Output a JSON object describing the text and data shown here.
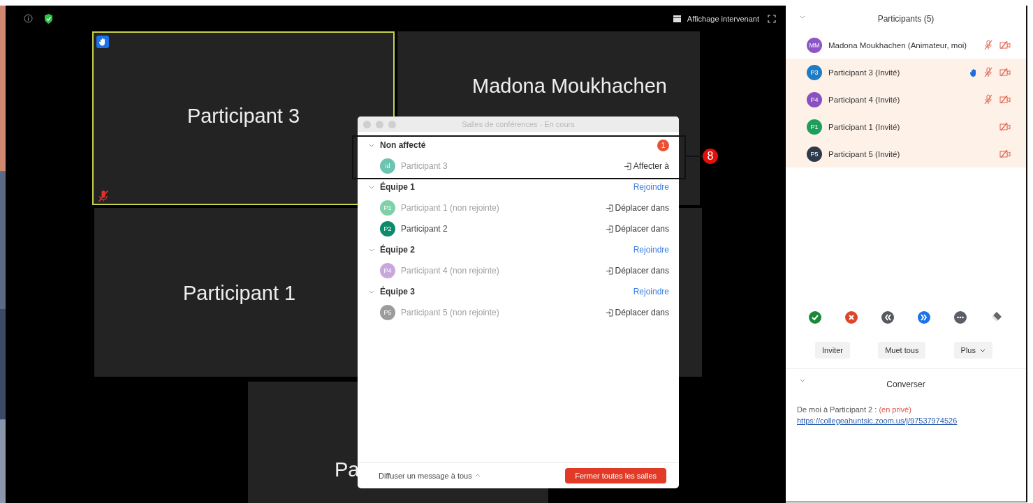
{
  "top_bar": {
    "view_label": "Affichage intervenant"
  },
  "tiles": [
    {
      "name": "Participant 3",
      "active": true,
      "hand_raised": true,
      "mic_muted": true
    },
    {
      "name": "Madona Moukhachen",
      "active": false,
      "hand_raised": false,
      "mic_muted": false
    },
    {
      "name": "Participant 1",
      "active": false,
      "hand_raised": false,
      "mic_muted": false
    },
    {
      "name": "Pa",
      "active": false,
      "hand_raised": false,
      "mic_muted": false
    }
  ],
  "dialog": {
    "title": "Salles de conférences - En cours",
    "groups": [
      {
        "name": "Non affecté",
        "badge": "1",
        "callout": "8",
        "members": [
          {
            "initials": "id",
            "name": "Participant 3",
            "color": "#6cc4b0",
            "joined": false,
            "action": "Affecter à"
          }
        ]
      },
      {
        "name": "Équipe 1",
        "link": "Rejoindre",
        "members": [
          {
            "initials": "P1",
            "name": "Participant 1 (non rejointe)",
            "color": "#80d0aa",
            "joined": false,
            "action": "Déplacer dans"
          },
          {
            "initials": "P2",
            "name": "Participant 2",
            "color": "#0b8a6c",
            "joined": true,
            "action": "Déplacer dans"
          }
        ]
      },
      {
        "name": "Équipe 2",
        "link": "Rejoindre",
        "members": [
          {
            "initials": "P4",
            "name": "Participant 4 (non rejointe)",
            "color": "#c8a8dc",
            "joined": false,
            "action": "Déplacer dans"
          }
        ]
      },
      {
        "name": "Équipe 3",
        "link": "Rejoindre",
        "members": [
          {
            "initials": "P5",
            "name": "Participant 5 (non rejointe)",
            "color": "#9c9c9c",
            "joined": false,
            "action": "Déplacer dans"
          }
        ]
      }
    ],
    "broadcast": "Diffuser un message à tous",
    "close_button": "Fermer toutes les salles"
  },
  "participants_panel": {
    "title": "Participants (5)",
    "participants": [
      {
        "initials": "MM",
        "name": "Madona Moukhachen (Animateur, moi)",
        "color": "#8e55c6",
        "highlighted": false,
        "hand_raised": false,
        "mic_muted": true,
        "video_off": true
      },
      {
        "initials": "P3",
        "name": "Participant 3 (Invité)",
        "color": "#1e7cc4",
        "highlighted": true,
        "hand_raised": true,
        "mic_muted": true,
        "video_off": true
      },
      {
        "initials": "P4",
        "name": "Participant 4 (Invité)",
        "color": "#8a50c2",
        "highlighted": true,
        "hand_raised": false,
        "mic_muted": true,
        "video_off": true
      },
      {
        "initials": "P1",
        "name": "Participant 1 (Invité)",
        "color": "#1e9e5c",
        "highlighted": true,
        "hand_raised": false,
        "mic_muted": false,
        "video_off": true
      },
      {
        "initials": "P5",
        "name": "Participant 5 (Invité)",
        "color": "#2e3a4a",
        "highlighted": true,
        "hand_raised": false,
        "mic_muted": false,
        "video_off": true
      }
    ],
    "reactions": [
      {
        "kind": "yes"
      },
      {
        "kind": "no"
      },
      {
        "kind": "slower"
      },
      {
        "kind": "faster"
      },
      {
        "kind": "more"
      },
      {
        "kind": "clear"
      }
    ],
    "buttons": [
      {
        "label": "Inviter",
        "dropdown": false
      },
      {
        "label": "Muet tous",
        "dropdown": false
      },
      {
        "label": "Plus",
        "dropdown": true
      }
    ]
  },
  "chat": {
    "title": "Converser",
    "sender": "De moi à Participant 2 :",
    "privacy": "(en privé)",
    "link": "https://collegeahuntsic.zoom.us/j/97537974526"
  }
}
